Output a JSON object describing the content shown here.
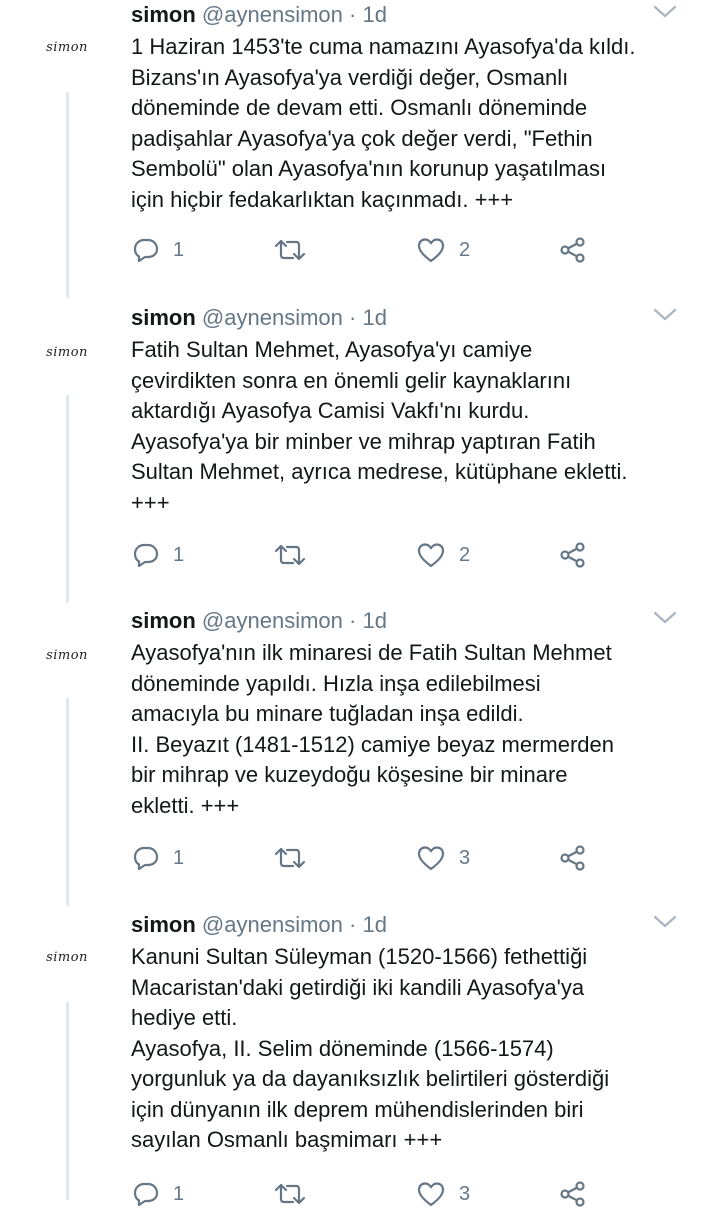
{
  "tweets": [
    {
      "avatar_text": "simon",
      "name": "simon",
      "handle": "@aynensimon",
      "dot": "·",
      "time": "1d",
      "text": "1 Haziran 1453'te cuma namazını Ayasofya'da kıldı.\nBizans'ın Ayasofya'ya verdiği değer, Osmanlı\ndöneminde de devam etti. Osmanlı döneminde\npadişahlar Ayasofya'ya çok değer verdi, \"Fethin\nSembolü\" olan Ayasofya'nın korunup yaşatılması\niçin hiçbir fedakarlıktan kaçınmadı. +++",
      "reply_count": "1",
      "retweet_count": "",
      "like_count": "2"
    },
    {
      "avatar_text": "simon",
      "name": "simon",
      "handle": "@aynensimon",
      "dot": "·",
      "time": "1d",
      "text": "Fatih Sultan Mehmet, Ayasofya'yı camiye\nçevirdikten sonra en önemli gelir kaynaklarını\naktardığı Ayasofya Camisi Vakfı'nı kurdu.\nAyasofya'ya bir minber ve mihrap yaptıran Fatih\nSultan Mehmet, ayrıca medrese, kütüphane ekletti.\n+++",
      "reply_count": "1",
      "retweet_count": "",
      "like_count": "2"
    },
    {
      "avatar_text": "simon",
      "name": "simon",
      "handle": "@aynensimon",
      "dot": "·",
      "time": "1d",
      "text": "Ayasofya'nın ilk minaresi de Fatih Sultan Mehmet\ndöneminde yapıldı. Hızla inşa edilebilmesi\namacıyla bu minare tuğladan inşa edildi.\nII. Beyazıt (1481-1512) camiye beyaz mermerden\nbir mihrap ve kuzeydoğu köşesine bir minare\nekletti. +++",
      "reply_count": "1",
      "retweet_count": "",
      "like_count": "3"
    },
    {
      "avatar_text": "simon",
      "name": "simon",
      "handle": "@aynensimon",
      "dot": "·",
      "time": "1d",
      "text": "Kanuni Sultan Süleyman (1520-1566) fethettiği\nMacaristan'daki getirdiği iki kandili Ayasofya'ya\nhediye etti.\nAyasofya, II. Selim döneminde (1566-1574)\nyorgunluk ya da dayanıksızlık belirtileri gösterdiği\niçin dünyanın ilk deprem mühendislerinden biri\nsayılan Osmanlı başmimarı +++",
      "reply_count": "1",
      "retweet_count": "",
      "like_count": "3"
    }
  ],
  "colors": {
    "text": "#14171a",
    "secondary": "#657786",
    "thread_line": "#e1e8ed",
    "background": "#ffffff"
  },
  "icons": {
    "reply": "reply-icon",
    "retweet": "retweet-icon",
    "like": "heart-icon",
    "share": "share-icon",
    "more": "chevron-down-icon"
  }
}
